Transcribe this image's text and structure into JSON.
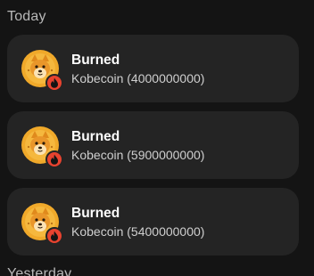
{
  "sections": {
    "today": "Today",
    "yesterday": "Yesterday"
  },
  "transactions": [
    {
      "title": "Burned",
      "subtitle": "Kobecoin (4000000000)"
    },
    {
      "title": "Burned",
      "subtitle": "Kobecoin (5900000000)"
    },
    {
      "title": "Burned",
      "subtitle": "Kobecoin (5400000000)"
    }
  ],
  "icons": {
    "token": "shiba-dog-coin-icon",
    "badge": "fire-icon"
  },
  "colors": {
    "background": "#141414",
    "card": "#242424",
    "coin": "#f0a92a",
    "badge": "#e8432f"
  }
}
